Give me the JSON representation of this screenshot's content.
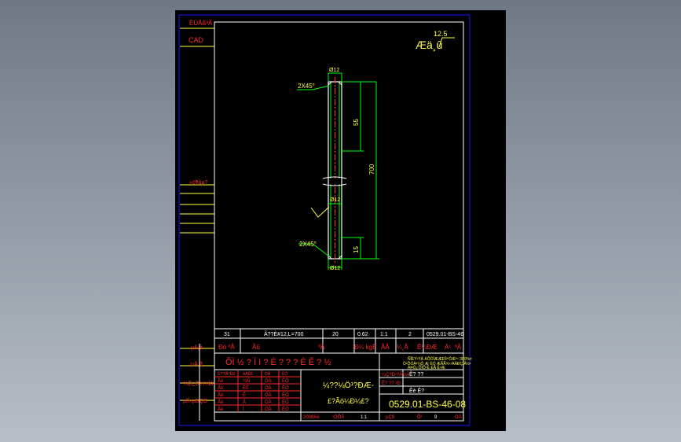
{
  "side_labels": {
    "top1": "ÈÚÂß³Ä",
    "top2": "CAD",
    "mid": "»ò¶ûµ?",
    "b1": "µÄ¸å",
    "b2": "µÄ¸ß",
    "b3": "¾Ö¿Ö¼¼Ìå",
    "b4": "µÏÎ»µÐÇÐ"
  },
  "roughness": {
    "prefix": "Æä¸û",
    "value": "12.5"
  },
  "drawing": {
    "dia_top": "Ø12",
    "chamfer_top": "2X45°",
    "dim_55": "55",
    "dim_700": "700",
    "dia_mid": "Ø12",
    "chamfer_bot": "2X45°",
    "dim_15": "15",
    "dia_bot": "Ø12"
  },
  "bom": {
    "cells": [
      "31",
      "Â??È#12,L=700",
      "20",
      "0.62",
      "1:1",
      "2",
      "0529.01-BS-46"
    ],
    "header": [
      "Ðò ºÅ",
      "Ãû",
      "ºÅ",
      "Ð¼ kgÊ",
      "ÃÅ",
      "¼¸Å",
      "Ê¼ÐÆ",
      "Ä¹",
      "ºÅ"
    ]
  },
  "title_block": {
    "wide_text": "ÕÏ ½ ? Ï ì ? É ? ? ? É Ê ? ½",
    "notes": [
      "ÑÎÈÝ¹ÝÄ ÁÕÒÎÆÆÐÎ²ºÔÆº¹ 300%±",
      "Ò¹ÕÒÀ²¼Ó¸Æ ÈÖ ÆÃÃ¾¹¹ÁÁÐÇÎÅ½¹",
      "ÁÞÓ¿ÕÏÔ¹Ê¸ÈÃ Ê¹Æ"
    ],
    "mid_text_1": "¼??¼Ö¹?ÐÆ-",
    "mid_text_2": "£?Ãö¼Ð¼£?",
    "right_small": [
      "¼Ç?Ð¹?Ã½Ä",
      "Ê? ?? ¹Ð"
    ],
    "right_small_2": [
      "Ê? ??",
      "Êè  Ê?"
    ],
    "drawing_no": "0529.01-BS-46-08",
    "rev_rows": [
      [
        "Åè",
        "¼Ñ",
        "ÒÁ",
        "ÈÓ"
      ],
      [
        "Åè",
        "ÈÉ",
        "ÒÁ",
        "ÈÓ"
      ],
      [
        "Åè",
        "Ê",
        "ÒÁ",
        "ÈÓ"
      ],
      [
        "Åè",
        "Å",
        "ÒÁ",
        "ÈÓ"
      ],
      [
        "Åè",
        "Ì",
        "ÒÁ",
        "ÈÓ"
      ]
    ],
    "rev_header": [
      "Ê??ÌÅ°ÊÐ",
      "ÀÁÊÈ",
      "ÒÁ",
      "ÈÓ"
    ],
    "bottom": [
      "2008Äê",
      "¹ÒÕÅ",
      "1:1",
      "µÇ9",
      "Õ¹",
      "9",
      "ÒÁ"
    ]
  },
  "colors": {
    "frame_blue": "#1a1aff",
    "line_white": "#ffffff",
    "red": "#ff2a2a",
    "yellow": "#ffff40",
    "green": "#00ff00",
    "cyan": "#00ffff"
  }
}
